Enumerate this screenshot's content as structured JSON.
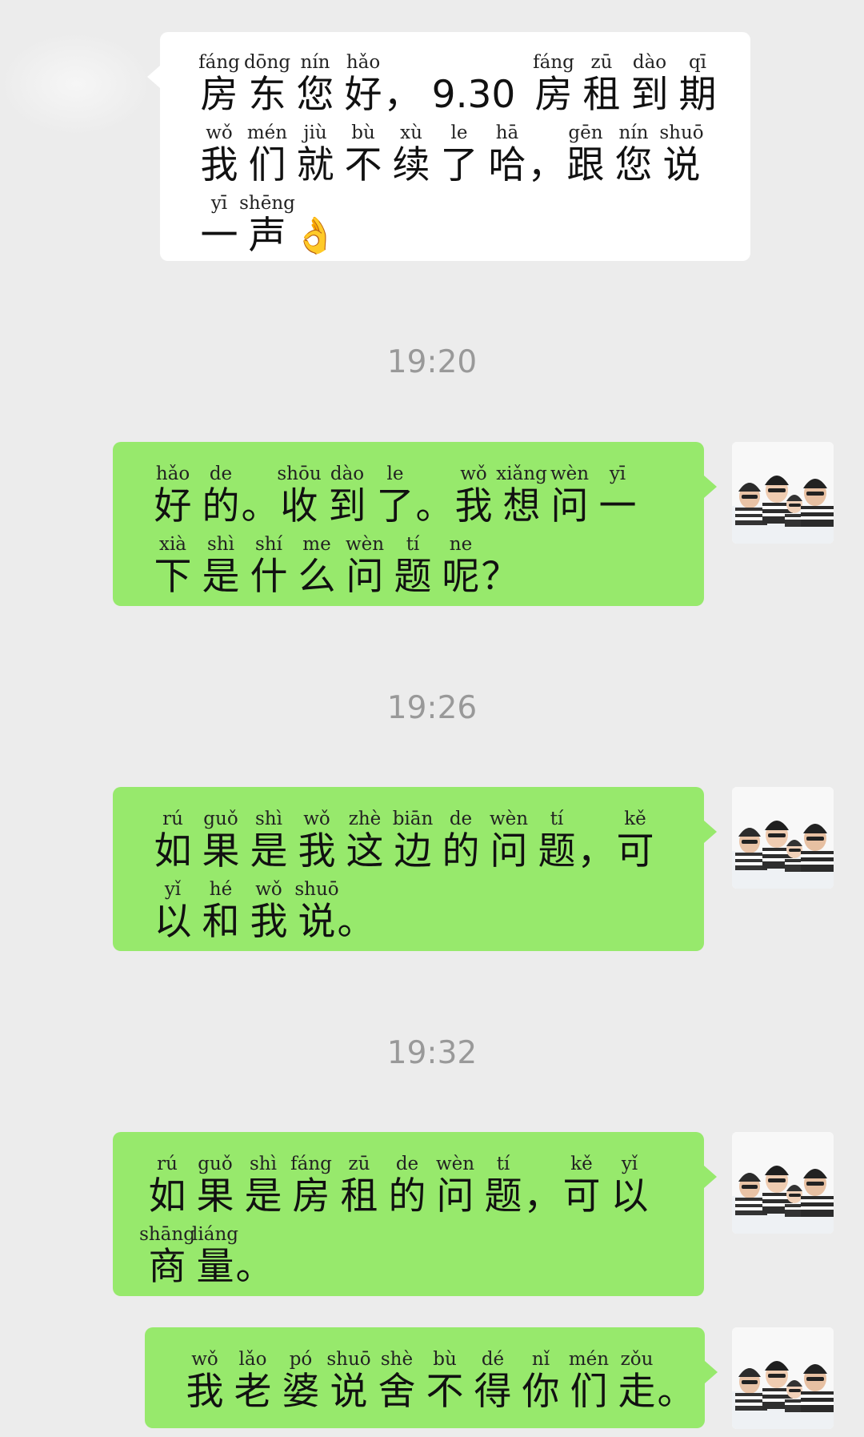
{
  "messages": [
    {
      "side": "left",
      "lines": [
        [
          [
            "fáng",
            "房"
          ],
          [
            "dōng",
            "东"
          ],
          [
            "nín",
            "您"
          ],
          [
            "hǎo",
            "好"
          ],
          [
            "",
            "，"
          ],
          [
            "",
            "9.30"
          ],
          [
            "fáng",
            "房"
          ],
          [
            "zū",
            "租"
          ],
          [
            "dào",
            "到"
          ],
          [
            "qī",
            "期"
          ]
        ],
        [
          [
            "wǒ",
            "我"
          ],
          [
            "mén",
            "们"
          ],
          [
            "jiù",
            "就"
          ],
          [
            "bù",
            "不"
          ],
          [
            "xù",
            "续"
          ],
          [
            "le",
            "了"
          ],
          [
            "hā",
            "哈"
          ],
          [
            "",
            "，"
          ],
          [
            "gēn",
            "跟"
          ],
          [
            "nín",
            "您"
          ],
          [
            "shuō",
            "说"
          ]
        ],
        [
          [
            "yī",
            "一"
          ],
          [
            "shēng",
            "声"
          ],
          [
            "",
            "👌"
          ]
        ]
      ]
    },
    {
      "time": "19:20"
    },
    {
      "side": "right",
      "lines": [
        [
          [
            "hǎo",
            "好"
          ],
          [
            "de",
            "的"
          ],
          [
            "",
            "。"
          ],
          [
            "shōu",
            "收"
          ],
          [
            "dào",
            "到"
          ],
          [
            "le",
            "了"
          ],
          [
            "",
            "。"
          ],
          [
            "wǒ",
            "我"
          ],
          [
            "xiǎng",
            "想"
          ],
          [
            "wèn",
            "问"
          ],
          [
            "yī",
            "一"
          ]
        ],
        [
          [
            "xià",
            "下"
          ],
          [
            "shì",
            "是"
          ],
          [
            "shí",
            "什"
          ],
          [
            "me",
            "么"
          ],
          [
            "wèn",
            "问"
          ],
          [
            "tí",
            "题"
          ],
          [
            "ne",
            "呢"
          ],
          [
            "",
            "？"
          ]
        ]
      ]
    },
    {
      "time": "19:26"
    },
    {
      "side": "right",
      "lines": [
        [
          [
            "rú",
            "如"
          ],
          [
            "guǒ",
            "果"
          ],
          [
            "shì",
            "是"
          ],
          [
            "wǒ",
            "我"
          ],
          [
            "zhè",
            "这"
          ],
          [
            "biān",
            "边"
          ],
          [
            "de",
            "的"
          ],
          [
            "wèn",
            "问"
          ],
          [
            "tí",
            "题"
          ],
          [
            "",
            "，"
          ],
          [
            "kě",
            "可"
          ]
        ],
        [
          [
            "yǐ",
            "以"
          ],
          [
            "hé",
            "和"
          ],
          [
            "wǒ",
            "我"
          ],
          [
            "shuō",
            "说"
          ],
          [
            "",
            "。"
          ]
        ]
      ]
    },
    {
      "time": "19:32"
    },
    {
      "side": "right",
      "lines": [
        [
          [
            "rú",
            "如"
          ],
          [
            "guǒ",
            "果"
          ],
          [
            "shì",
            "是"
          ],
          [
            "fáng",
            "房"
          ],
          [
            "zū",
            "租"
          ],
          [
            "de",
            "的"
          ],
          [
            "wèn",
            "问"
          ],
          [
            "tí",
            "题"
          ],
          [
            "",
            "，"
          ],
          [
            "kě",
            "可"
          ],
          [
            "yǐ",
            "以"
          ]
        ],
        [
          [
            "shāng",
            "商"
          ],
          [
            "liáng",
            "量"
          ],
          [
            "",
            "。"
          ]
        ]
      ]
    },
    {
      "side": "right",
      "lines": [
        [
          [
            "wǒ",
            "我"
          ],
          [
            "lǎo",
            "老"
          ],
          [
            "pó",
            "婆"
          ],
          [
            "shuō",
            "说"
          ],
          [
            "shè",
            "舍"
          ],
          [
            "bù",
            "不"
          ],
          [
            "dé",
            "得"
          ],
          [
            "nǐ",
            "你"
          ],
          [
            "mén",
            "们"
          ],
          [
            "zǒu",
            "走"
          ],
          [
            "",
            "。"
          ]
        ]
      ]
    }
  ],
  "colors": {
    "background": "#ececec",
    "bubble_left": "#ffffff",
    "bubble_right": "#97e96c",
    "timestamp": "#999999"
  },
  "icons": {
    "avatar": "family-photo-avatar",
    "emoji": "ok-hand-emoji"
  }
}
